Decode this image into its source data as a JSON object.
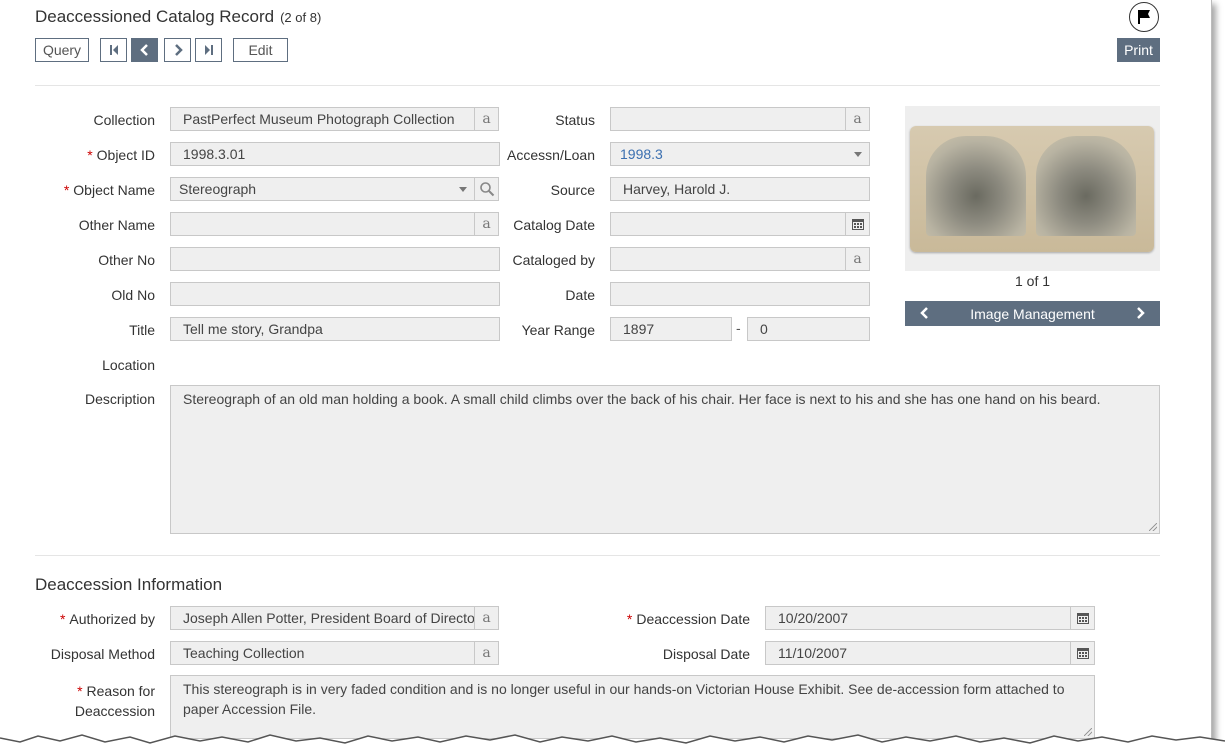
{
  "header": {
    "title": "Deaccessioned Catalog Record",
    "record_count": "(2 of 8)",
    "query_label": "Query",
    "edit_label": "Edit",
    "print_label": "Print"
  },
  "form": {
    "collection": {
      "label": "Collection",
      "value": "PastPerfect Museum Photograph Collection"
    },
    "object_id": {
      "label": "Object ID",
      "value": "1998.3.01"
    },
    "object_name": {
      "label": "Object Name",
      "value": "Stereograph"
    },
    "other_name": {
      "label": "Other Name",
      "value": ""
    },
    "other_no": {
      "label": "Other No",
      "value": ""
    },
    "old_no": {
      "label": "Old No",
      "value": ""
    },
    "title": {
      "label": "Title",
      "value": "Tell me story, Grandpa"
    },
    "location": {
      "label": "Location"
    },
    "description": {
      "label": "Description",
      "value": "Stereograph of an old man holding a book.  A small child climbs over the back of his chair.  Her face is next to his and she has one hand on his beard."
    },
    "status": {
      "label": "Status",
      "value": ""
    },
    "accessn_loan": {
      "label": "Accessn/Loan",
      "value": "1998.3"
    },
    "source": {
      "label": "Source",
      "value": "Harvey, Harold J."
    },
    "catalog_date": {
      "label": "Catalog Date",
      "value": ""
    },
    "cataloged_by": {
      "label": "Cataloged by",
      "value": ""
    },
    "date": {
      "label": "Date",
      "value": ""
    },
    "year_range": {
      "label": "Year Range",
      "from": "1897",
      "sep": "-",
      "to": "0"
    }
  },
  "image": {
    "counter": "1 of 1",
    "management_label": "Image Management"
  },
  "deaccession": {
    "section_title": "Deaccession Information",
    "authorized_by": {
      "label": "Authorized by",
      "value": "Joseph Allen Potter, President Board of Directors"
    },
    "disposal_method": {
      "label": "Disposal Method",
      "value": "Teaching Collection"
    },
    "reason": {
      "label_line1": "Reason for",
      "label_line2": "Deaccession",
      "value": "This stereograph is in very faded condition and is no longer useful in our hands-on Victorian House Exhibit.  See de-accession form attached to paper Accession File."
    },
    "deaccession_date": {
      "label": "Deaccession Date",
      "value": "10/20/2007"
    },
    "disposal_date": {
      "label": "Disposal Date",
      "value": "11/10/2007"
    }
  },
  "icons": {
    "text_suffix": "a",
    "flag": "flag-icon",
    "calendar": "calendar-icon",
    "search": "search-icon"
  },
  "colors": {
    "accent": "#5e6e80",
    "required": "#cc0000",
    "link": "#3a6fb0",
    "field_bg": "#efefef"
  }
}
